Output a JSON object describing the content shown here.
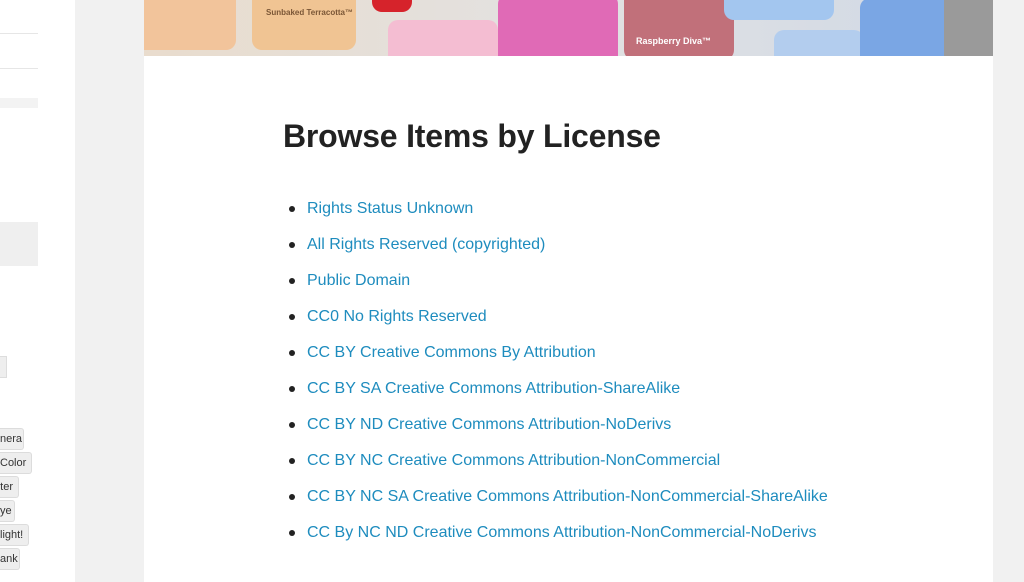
{
  "banner": {
    "chips": [
      {
        "label": "",
        "sub": "",
        "color": "#f2c49b"
      },
      {
        "label": "Sunbaked Terracotta™",
        "sub": "",
        "color": "#f2c49b"
      },
      {
        "label": "",
        "sub": "",
        "color": "#d6232b"
      },
      {
        "label": "",
        "sub": "",
        "color": "#f2b9cf"
      },
      {
        "label": "",
        "sub": "",
        "color": "#e070b8"
      },
      {
        "label": "Raspberry Diva™",
        "sub": "",
        "color": "#c06a78"
      },
      {
        "label": "",
        "sub": "",
        "color": "#9dc2ee"
      },
      {
        "label": "",
        "sub": "",
        "color": "#7aa6e4"
      }
    ]
  },
  "sidebar": {
    "tags": [
      "nera",
      "Color",
      "ter",
      "ye",
      "light!",
      "ank"
    ]
  },
  "main": {
    "title": "Browse Items by License",
    "licenses": [
      "Rights Status Unknown",
      "All Rights Reserved (copyrighted)",
      "Public Domain",
      "CC0 No Rights Reserved",
      "CC BY Creative Commons By Attribution",
      "CC BY SA Creative Commons Attribution-ShareAlike",
      "CC BY ND Creative Commons Attribution-NoDerivs",
      "CC BY NC Creative Commons Attribution-NonCommercial",
      "CC BY NC SA Creative Commons Attribution-NonCommercial-ShareAlike",
      "CC By NC ND Creative Commons Attribution-NonCommercial-NoDerivs"
    ]
  },
  "colors": {
    "link": "#1e8cbe",
    "heading": "#222222",
    "background": "#f1f1f1",
    "panel": "#ffffff"
  }
}
